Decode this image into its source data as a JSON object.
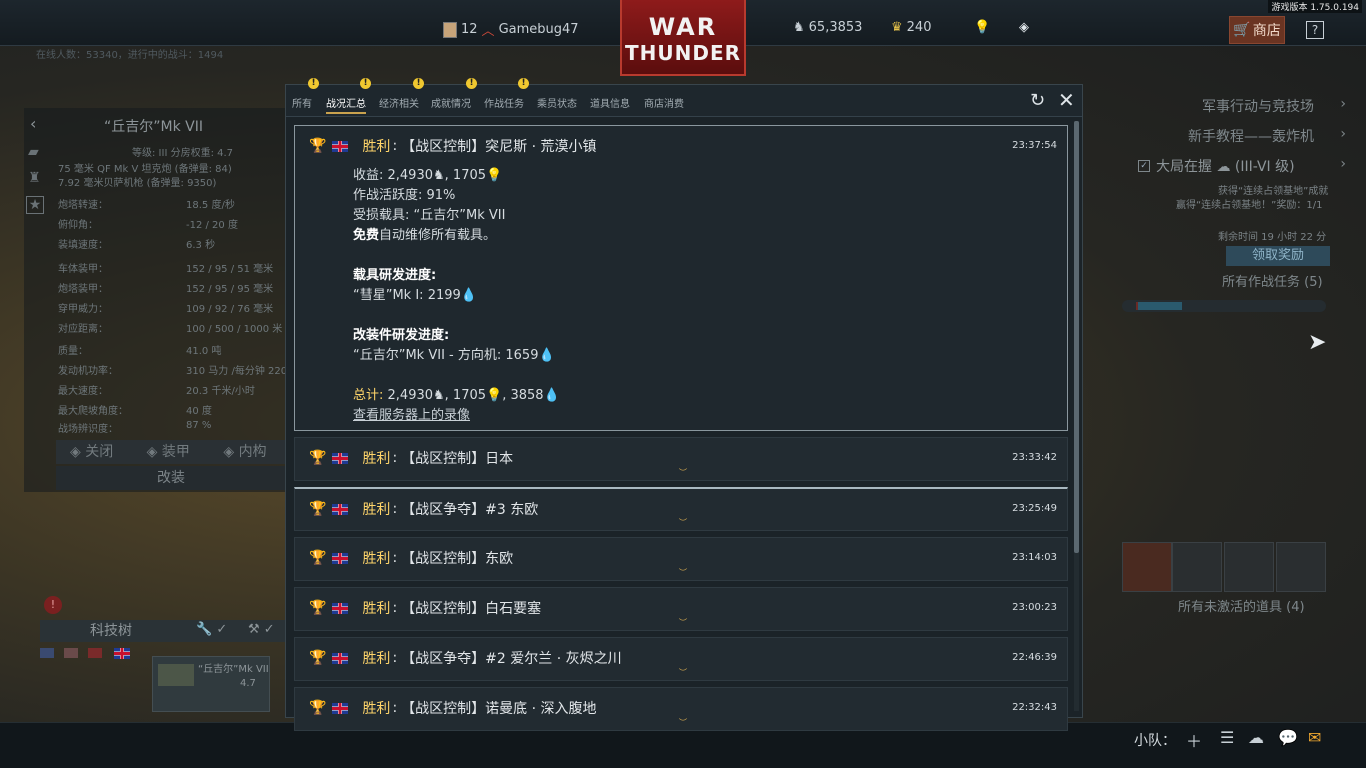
{
  "version": "游戏版本 1.75.0.194",
  "topbar": {
    "rank": "12",
    "username": "Gamebug47",
    "silver": "65,3853",
    "gold": "240",
    "shop": "商店",
    "help": "?"
  },
  "logo": {
    "line1": "WAR",
    "line2": "THUNDER"
  },
  "background": {
    "online": "在线人数：53340，进行中的战斗：1494",
    "vehicle_title": "“丘吉尔”Mk VII",
    "rank_line": "等级: III    分房权重: 4.7",
    "weapon1": "75 毫米 QF Mk V 坦克炮 (备弹量: 84)",
    "weapon2": "7.92 毫米贝萨机枪 (备弹量: 9350)",
    "stats": [
      {
        "label": "炮塔转速：",
        "value": "18.5 度/秒"
      },
      {
        "label": "俯仰角：",
        "value": "-12 / 20 度"
      },
      {
        "label": "装填速度：",
        "value": "6.3 秒"
      },
      {
        "label": "车体装甲：",
        "value": "152 / 95 / 51 毫米"
      },
      {
        "label": "炮塔装甲：",
        "value": "152 / 95 / 95 毫米"
      },
      {
        "label": "穿甲威力：",
        "value": "109 / 92 / 76 毫米"
      },
      {
        "label": "对应距离：",
        "value": "100 / 500 / 1000 米"
      },
      {
        "label": "质量：",
        "value": "41.0 吨"
      },
      {
        "label": "发动机功率：",
        "value": "310 马力 /每分钟 220"
      },
      {
        "label": "最大速度：",
        "value": "20.3 千米/小时"
      },
      {
        "label": "最大爬坡角度：",
        "value": "40 度"
      },
      {
        "label": "战场辨识度：",
        "value": "87 %"
      }
    ],
    "tabs": [
      "关闭",
      "装甲",
      "内构"
    ],
    "mod": "改装",
    "techtree": "科技树",
    "vehicle_card_name": "“丘吉尔”Mk VII",
    "vehicle_card_rank": "4.7",
    "right_menu": [
      "军事行动与竞技场",
      "新手教程——轰炸机"
    ],
    "mission": "大局在握 ☁ (III-VI 级)",
    "mission_sub1": "获得“连续占领基地”成就",
    "mission_sub2": "赢得“连续占领基地！”奖励：1/1",
    "mission_time": "剩余时间 19 小时 22 分",
    "claim": "领取奖励",
    "all_missions": "所有作战任务 (5)",
    "inactive_items": "所有未激活的道具 (4)"
  },
  "modal": {
    "tabs": [
      "所有",
      "战况汇总",
      "经济相关",
      "成就情况",
      "作战任务",
      "乘员状态",
      "道具信息",
      "商店消费"
    ],
    "active_tab": "战况汇总",
    "expanded": {
      "result": "胜利",
      "mode": "【战区控制】突尼斯 · 荒漠小镇",
      "time": "23:37:54",
      "income": "收益: 2,4930",
      "income_rp": ", 1705",
      "activity": "作战活跃度: 91%",
      "damaged": "受损载具: “丘吉尔”Mk VII",
      "repair_bold": "免费",
      "repair_rest": "自动维修所有载具。",
      "research_title": "载具研发进度:",
      "research_item": "“彗星”Mk I: 2199",
      "mod_title": "改装件研发进度:",
      "mod_item": "“丘吉尔”Mk VII - 方向机: 1659",
      "total_label": "总计:",
      "total_value": " 2,4930",
      "total_rp": ", 1705",
      "total_exp": ", 3858",
      "replay": "查看服务器上的录像"
    },
    "entries": [
      {
        "result": "胜利",
        "mode": "【战区控制】日本",
        "time": "23:33:42"
      },
      {
        "result": "胜利",
        "mode": "【战区争夺】#3 东欧",
        "time": "23:25:49"
      },
      {
        "result": "胜利",
        "mode": "【战区控制】东欧",
        "time": "23:14:03"
      },
      {
        "result": "胜利",
        "mode": "【战区控制】白石要塞",
        "time": "23:00:23"
      },
      {
        "result": "胜利",
        "mode": "【战区争夺】#2 爱尔兰 · 灰烬之川",
        "time": "22:46:39"
      },
      {
        "result": "胜利",
        "mode": "【战区控制】诺曼底 · 深入腹地",
        "time": "22:32:43"
      }
    ]
  },
  "bottombar": {
    "squad": "小队："
  }
}
